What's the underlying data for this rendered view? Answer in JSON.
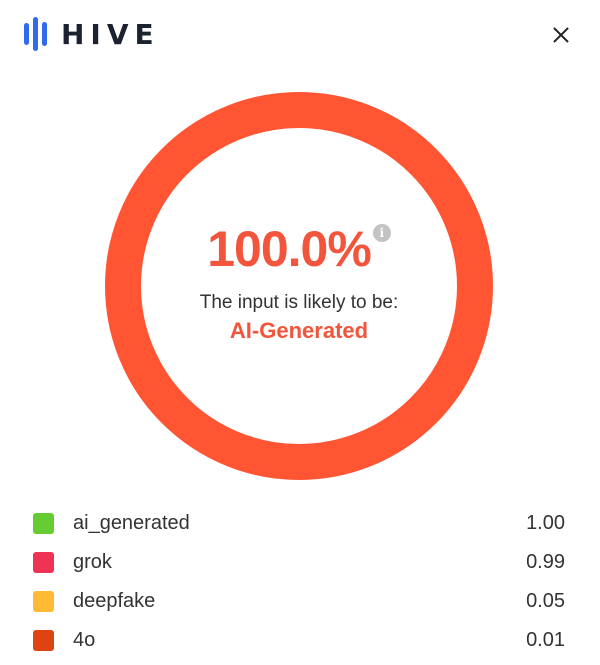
{
  "header": {
    "logo_text": "HIVE",
    "brand_color": "#2f6bea",
    "close_icon": "close-icon"
  },
  "result": {
    "percent": "100.0%",
    "info_icon_glyph": "i",
    "likely_text": "The input is likely to be:",
    "verdict": "AI-Generated",
    "ring_fraction": 1.0,
    "ring_color": "#ff5533"
  },
  "legend": [
    {
      "label": "ai_generated",
      "value": "1.00",
      "color": "#66cc33"
    },
    {
      "label": "grok",
      "value": "0.99",
      "color": "#ef3355"
    },
    {
      "label": "deepfake",
      "value": "0.05",
      "color": "#ffbb33"
    },
    {
      "label": "4o",
      "value": "0.01",
      "color": "#dd4411"
    }
  ]
}
